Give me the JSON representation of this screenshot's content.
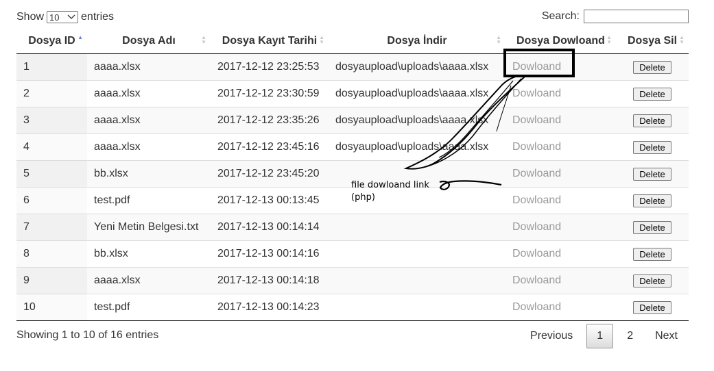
{
  "length": {
    "prefix": "Show",
    "value": "10",
    "suffix": "entries"
  },
  "search": {
    "label": "Search:",
    "value": ""
  },
  "columns": [
    "Dosya ID",
    "Dosya Adı",
    "Dosya Kayıt Tarihi",
    "Dosya İndir",
    "Dosya Dowloand",
    "Dosya Sil"
  ],
  "rows": [
    {
      "id": "1",
      "name": "aaaa.xlsx",
      "date": "2017-12-12 23:25:53",
      "path": "dosyaupload\\uploads\\aaaa.xlsx",
      "download": "Dowloand",
      "delete": "Delete"
    },
    {
      "id": "2",
      "name": "aaaa.xlsx",
      "date": "2017-12-12 23:30:59",
      "path": "dosyaupload\\uploads\\aaaa.xlsx",
      "download": "Dowloand",
      "delete": "Delete"
    },
    {
      "id": "3",
      "name": "aaaa.xlsx",
      "date": "2017-12-12 23:35:26",
      "path": "dosyaupload\\uploads\\aaaa.xlsx",
      "download": "Dowloand",
      "delete": "Delete"
    },
    {
      "id": "4",
      "name": "aaaa.xlsx",
      "date": "2017-12-12 23:45:16",
      "path": "dosyaupload\\uploads\\aaaa.xlsx",
      "download": "Dowloand",
      "delete": "Delete"
    },
    {
      "id": "5",
      "name": "bb.xlsx",
      "date": "2017-12-12 23:45:20",
      "path": "",
      "download": "Dowloand",
      "delete": "Delete"
    },
    {
      "id": "6",
      "name": "test.pdf",
      "date": "2017-12-13 00:13:45",
      "path": "",
      "download": "Dowloand",
      "delete": "Delete"
    },
    {
      "id": "7",
      "name": "Yeni Metin Belgesi.txt",
      "date": "2017-12-13 00:14:14",
      "path": "",
      "download": "Dowloand",
      "delete": "Delete"
    },
    {
      "id": "8",
      "name": "bb.xlsx",
      "date": "2017-12-13 00:14:16",
      "path": "",
      "download": "Dowloand",
      "delete": "Delete"
    },
    {
      "id": "9",
      "name": "aaaa.xlsx",
      "date": "2017-12-13 00:14:18",
      "path": "",
      "download": "Dowloand",
      "delete": "Delete"
    },
    {
      "id": "10",
      "name": "test.pdf",
      "date": "2017-12-13 00:14:23",
      "path": "",
      "download": "Dowloand",
      "delete": "Delete"
    }
  ],
  "info": "Showing 1 to 10 of 16 entries",
  "pagination": {
    "previous": "Previous",
    "pages": [
      "1",
      "2"
    ],
    "current": "1",
    "next": "Next"
  },
  "annotation": {
    "line1": "file dowloand link",
    "line2": "(php)"
  }
}
